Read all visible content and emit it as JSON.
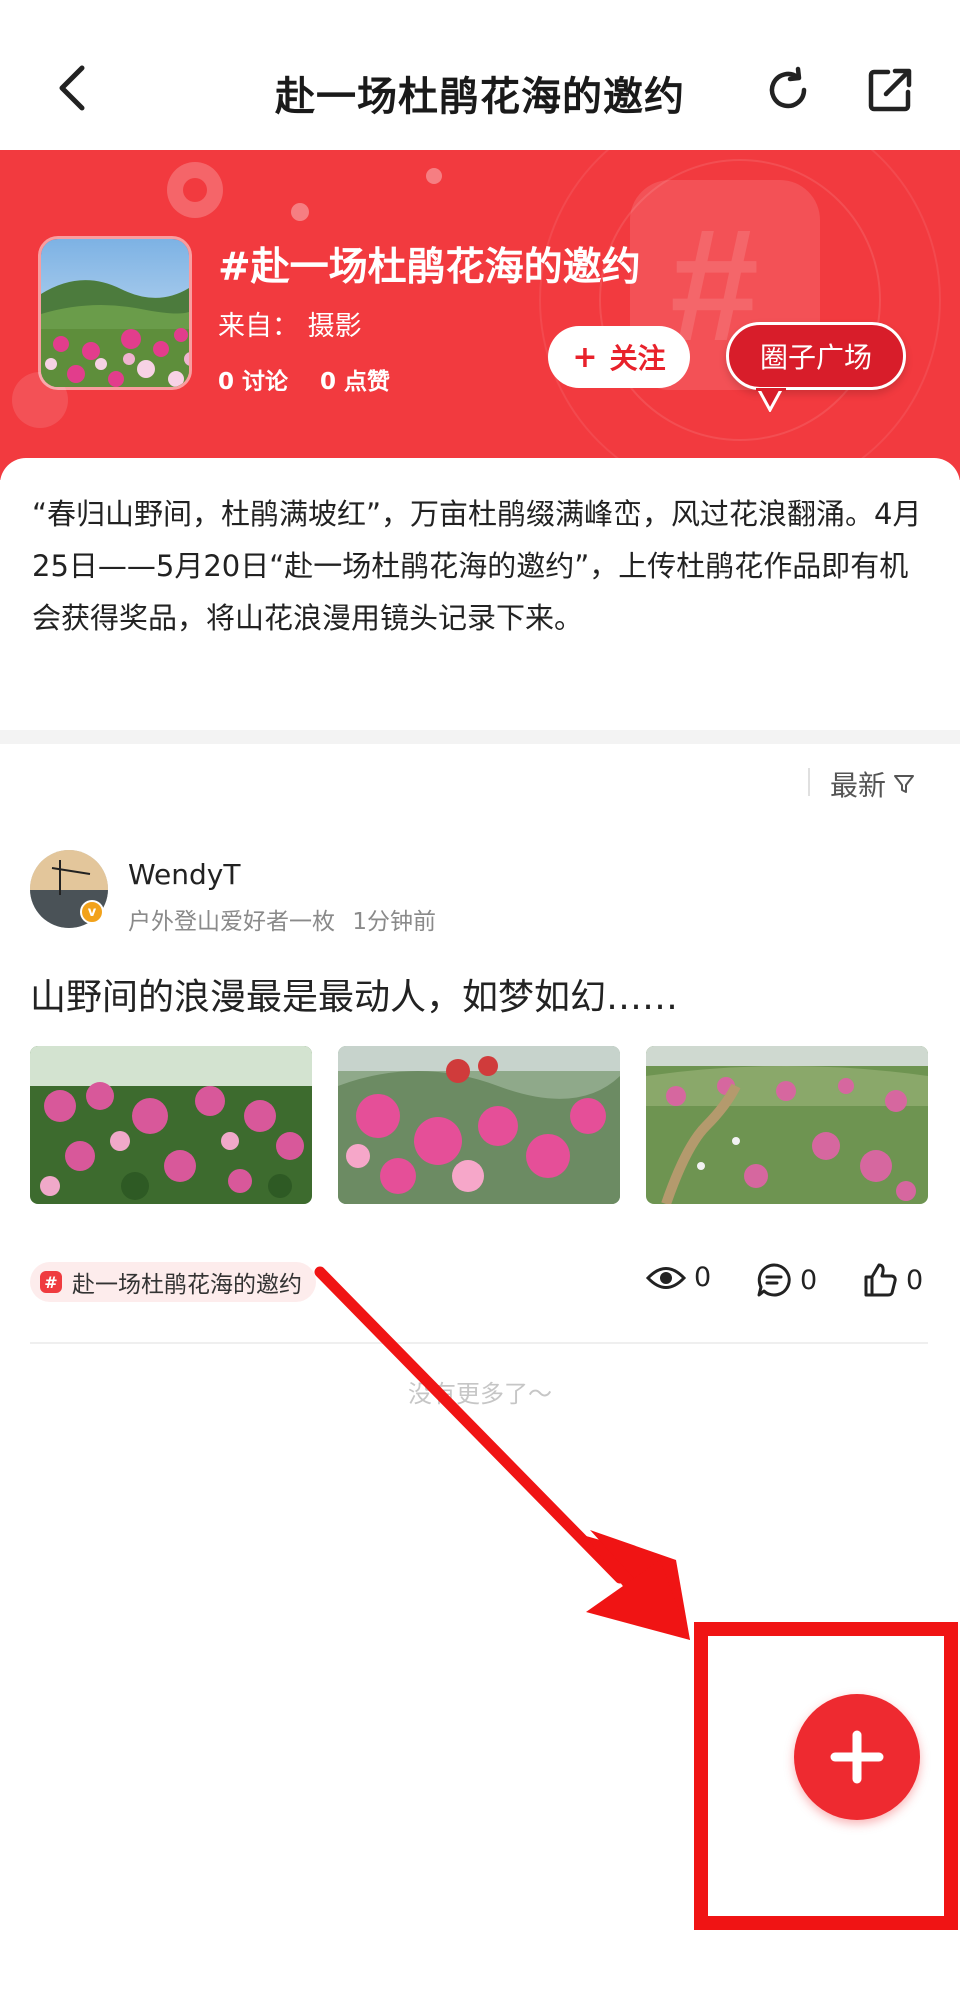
{
  "nav": {
    "title": "赴一场杜鹃花海的邀约"
  },
  "banner": {
    "title": "#赴一场杜鹃花海的邀约",
    "from_label": "来自：",
    "from_value": "摄影",
    "discussions": "0 讨论",
    "likes": "0 点赞",
    "follow_label": "关注",
    "square_label": "圈子广场",
    "color": "#f23a3f"
  },
  "description": "“春归山野间，杜鹃满坡红”，万亩杜鹃缀满峰峦，风过花浪翻涌。4月25日——5月20日“赴一场杜鹃花海的邀约”，上传杜鹃花作品即有机会获得奖品，将山花浪漫用镜头记录下来。",
  "sort": {
    "label": "最新"
  },
  "post": {
    "username": "WendyT",
    "user_title": "户外登山爱好者一枚",
    "time": "1分钟前",
    "text": "山野间的浪漫最是最动人，如梦如幻……",
    "tag": "赴一场杜鹃花海的邀约",
    "views": "0",
    "comments": "0",
    "likes": "0"
  },
  "footer": {
    "no_more": "没有更多了～"
  },
  "fab": {
    "color": "#ee2a30"
  }
}
